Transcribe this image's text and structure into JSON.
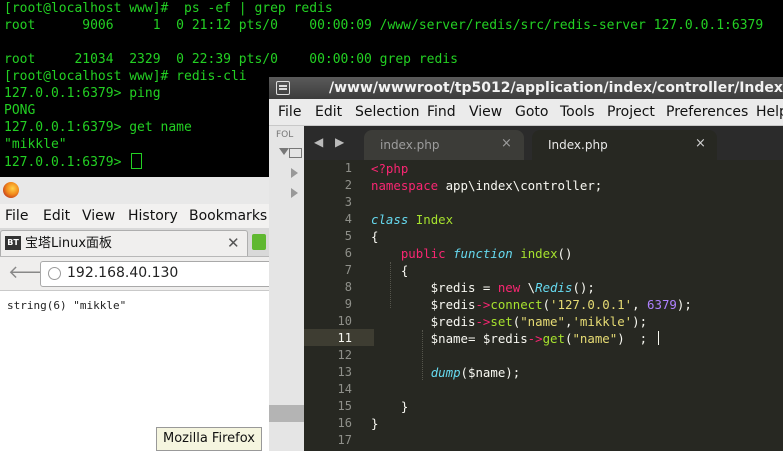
{
  "terminal": {
    "lines": [
      "[root@localhost www]#  ps -ef | grep redis",
      "root      9006     1  0 21:12 pts/0    00:00:09 /www/server/redis/src/redis-server 127.0.0.1:6379",
      "",
      "root     21034  2329  0 22:39 pts/0    00:00:00 grep redis",
      "[root@localhost www]# redis-cli",
      "127.0.0.1:6379> ping",
      "PONG",
      "127.0.0.1:6379> get name",
      "\"mikkle\"",
      "127.0.0.1:6379> "
    ]
  },
  "firefox": {
    "menu": [
      "File",
      "Edit",
      "View",
      "History",
      "Bookmarks"
    ],
    "tab_badge": "BT",
    "tab_title": "宝塔Linux面板",
    "tab_close": "✕",
    "url": "192.168.40.130",
    "output": "string(6) \"mikkle\"",
    "tooltip": "Mozilla Firefox"
  },
  "sublime": {
    "title": "/www/wwwroot/tp5012/application/index/controller/Index.php",
    "menu": [
      "File",
      "Edit",
      "Selection",
      "Find",
      "View",
      "Goto",
      "Tools",
      "Project",
      "Preferences",
      "Help"
    ],
    "sidebar_label": "FOL",
    "tab_arrows": "◀ ▶",
    "tabs": [
      {
        "label": "index.php",
        "close": "×"
      },
      {
        "label": "Index.php",
        "close": "×"
      }
    ],
    "line_numbers": [
      "1",
      "2",
      "3",
      "4",
      "5",
      "6",
      "7",
      "8",
      "9",
      "10",
      "11",
      "12",
      "13",
      "14",
      "15",
      "16",
      "17"
    ],
    "current_line": "11",
    "code": {
      "l1": {
        "t0": "<?php"
      },
      "l2": {
        "t0": "namespace",
        "t1": " app\\index\\controller;"
      },
      "l4": {
        "t0": "class",
        "t1": " ",
        "t2": "Index"
      },
      "l5": {
        "t0": "{"
      },
      "l6": {
        "t0": "    ",
        "t1": "public",
        "t2": " ",
        "t3": "function",
        "t4": " ",
        "t5": "index",
        "t6": "()"
      },
      "l7": {
        "t0": "    {"
      },
      "l8": {
        "t0": "        $redis = ",
        "t1": "new",
        "t2": " \\",
        "t3": "Redis",
        "t4": "();"
      },
      "l9": {
        "t0": "        $redis",
        "t1": "->",
        "t2": "connect",
        "t3": "(",
        "t4": "'127.0.0.1'",
        "t5": ", ",
        "t6": "6379",
        "t7": ");"
      },
      "l10": {
        "t0": "        $redis",
        "t1": "->",
        "t2": "set",
        "t3": "(",
        "t4": "\"name\"",
        "t5": ",",
        "t6": "'mikkle'",
        "t7": ");"
      },
      "l11": {
        "t0": "        $name= $redis",
        "t1": "->",
        "t2": "get",
        "t3": "(",
        "t4": "\"name\"",
        "t5": ")  ;"
      },
      "l13": {
        "t0": "        ",
        "t1": "dump",
        "t2": "($name);"
      },
      "l15": {
        "t0": "    }"
      },
      "l16": {
        "t0": "}"
      }
    }
  }
}
